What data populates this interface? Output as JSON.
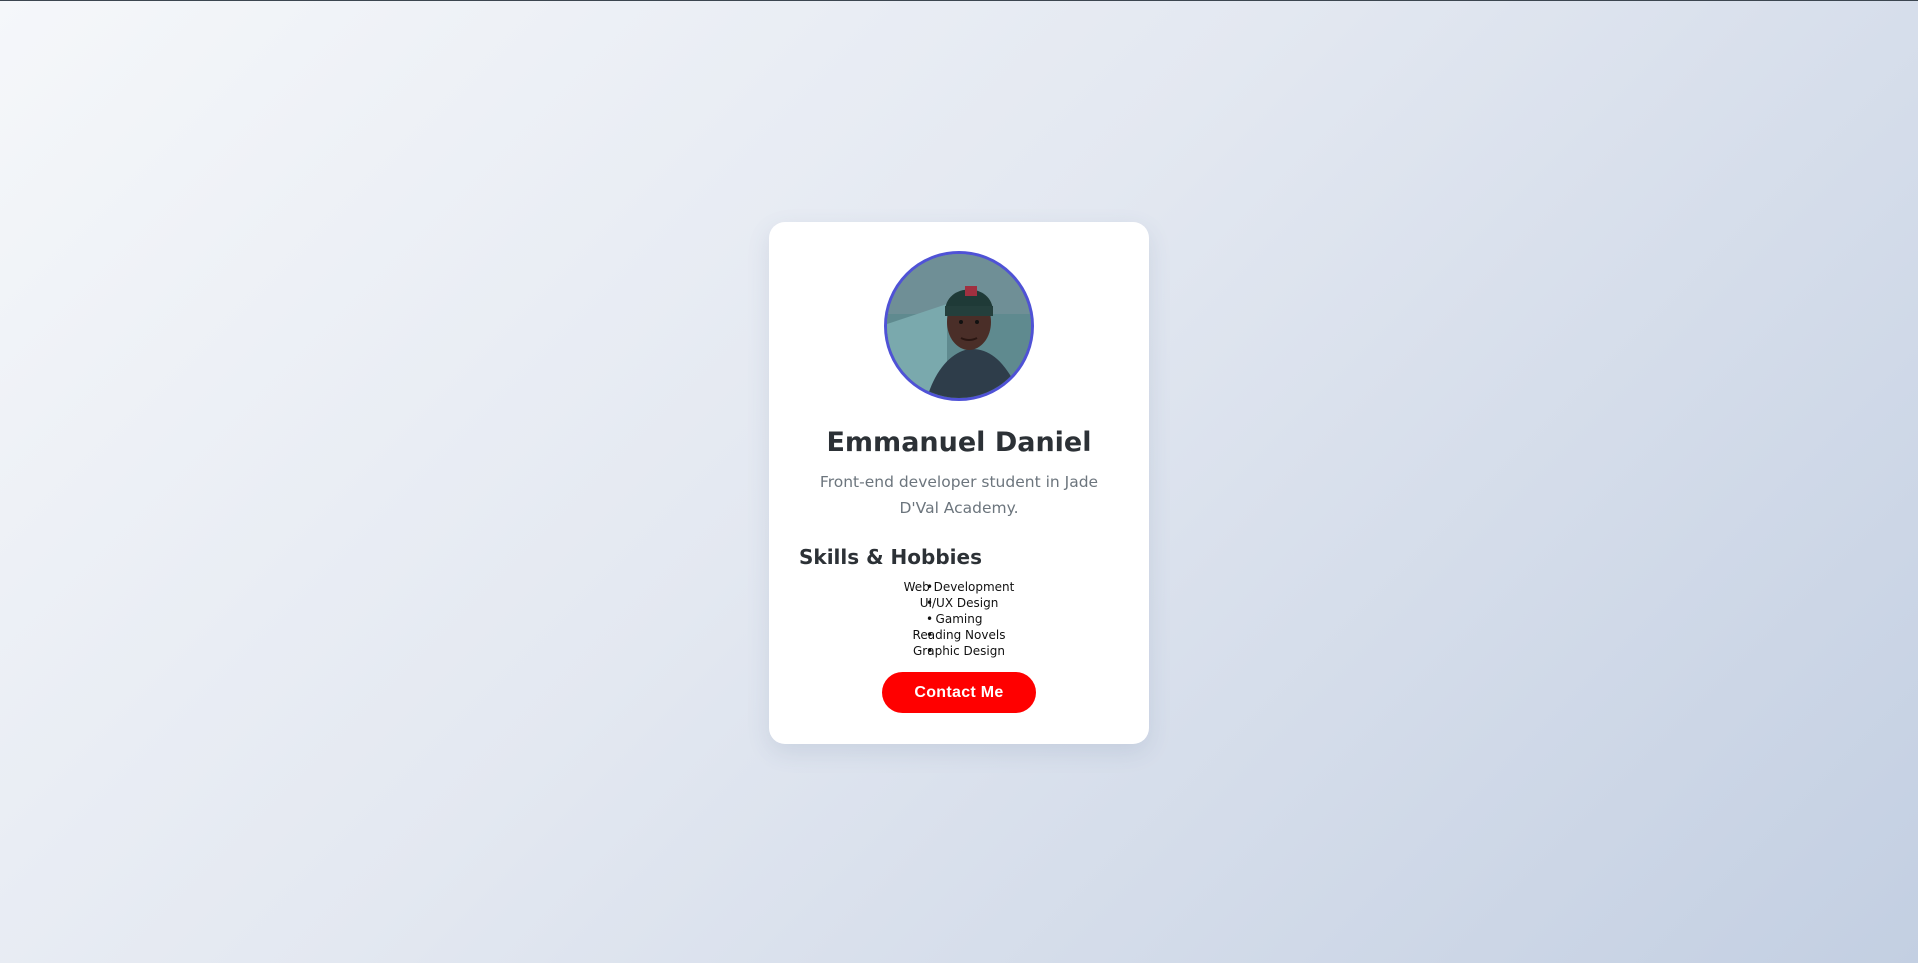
{
  "profile": {
    "name": "Emmanuel Daniel",
    "tagline": "Front-end developer student in Jade D'Val Academy."
  },
  "skills": {
    "title": "Skills & Hobbies",
    "items": [
      "Web Development",
      "UI/UX Design",
      "Gaming",
      "Reading Novels",
      "Graphic Design"
    ]
  },
  "contact": {
    "label": "Contact Me"
  },
  "colors": {
    "accent_border": "#4f52d6",
    "button": "#ff0000",
    "heading": "#2c3136",
    "muted": "#6c757d"
  }
}
